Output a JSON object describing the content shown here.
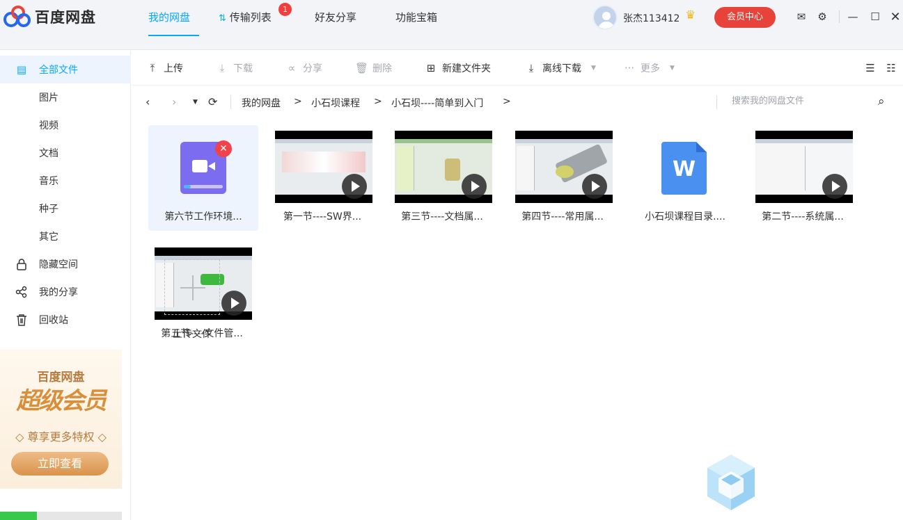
{
  "app": {
    "title": "百度网盘"
  },
  "nav": {
    "tabs": [
      "我的网盘",
      "传输列表",
      "好友分享",
      "功能宝箱"
    ],
    "transfer_badge": "1"
  },
  "user": {
    "name": "张杰113412",
    "vip_button": "会员中心"
  },
  "sidebar": {
    "items": [
      {
        "label": "全部文件",
        "icon": "file-list-icon"
      },
      {
        "label": "图片"
      },
      {
        "label": "视频"
      },
      {
        "label": "文档"
      },
      {
        "label": "音乐"
      },
      {
        "label": "种子"
      },
      {
        "label": "其它"
      },
      {
        "label": "隐藏空间",
        "icon": "lock-icon"
      },
      {
        "label": "我的分享",
        "icon": "share-icon"
      },
      {
        "label": "回收站",
        "icon": "trash-icon"
      }
    ],
    "promo": {
      "title": "百度网盘",
      "big": "超级会员",
      "sub": "◇ 尊享更多特权 ◇",
      "button": "立即查看"
    },
    "storage_fill": 0.3
  },
  "toolbar": {
    "upload": "上传",
    "download": "下载",
    "share": "分享",
    "delete": "删除",
    "new_folder": "新建文件夹",
    "offline": "离线下载",
    "more": "更多"
  },
  "address": {
    "crumbs": [
      "我的网盘",
      "小石坝课程",
      "小石坝----简单到入门"
    ],
    "search_placeholder": "搜索我的网盘文件"
  },
  "files": [
    {
      "name": "第六节工作环境...",
      "type": "video-file"
    },
    {
      "name": "第一节----SW界...",
      "type": "video"
    },
    {
      "name": "第三节----文档属...",
      "type": "video"
    },
    {
      "name": "第四节----常用属...",
      "type": "video"
    },
    {
      "name": "小石坝课程目录....",
      "type": "word"
    },
    {
      "name": "第二节----系统属...",
      "type": "video"
    },
    {
      "name": "第五节----文件管...",
      "type": "video"
    }
  ],
  "upload_tile": {
    "label": "上传文件"
  },
  "colors": {
    "accent": "#06a7ff",
    "vip": "#e8433a",
    "badge": "#f23d3d"
  }
}
